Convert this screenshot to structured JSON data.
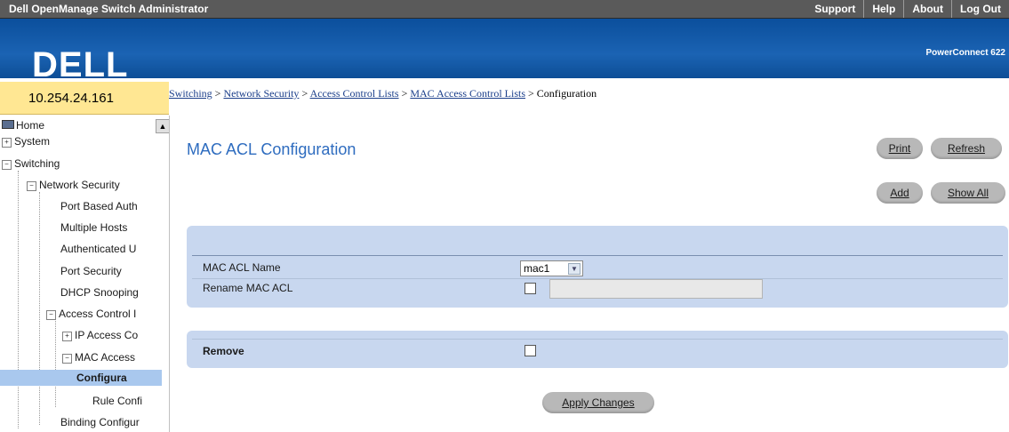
{
  "topbar": {
    "app_title": "Dell OpenManage Switch Administrator",
    "links": [
      "Support",
      "Help",
      "About",
      "Log Out"
    ]
  },
  "header": {
    "logo": "DELL",
    "product": "PowerConnect 622"
  },
  "ip_address": "10.254.24.161",
  "breadcrumb": {
    "items": [
      "Switching",
      "Network Security",
      "Access Control Lists",
      "MAC Access Control Lists"
    ],
    "current": "Configuration",
    "separator": ">"
  },
  "nav": {
    "items": [
      {
        "label": "Home"
      },
      {
        "label": "System"
      },
      {
        "label": "Switching"
      },
      {
        "label": "Network Security"
      },
      {
        "label": "Port Based Auth"
      },
      {
        "label": "Multiple Hosts"
      },
      {
        "label": "Authenticated U"
      },
      {
        "label": "Port Security"
      },
      {
        "label": "DHCP Snooping"
      },
      {
        "label": "Access Control I"
      },
      {
        "label": "IP Access Co"
      },
      {
        "label": "MAC Access"
      },
      {
        "label": "Configura"
      },
      {
        "label": "Rule Confi"
      },
      {
        "label": "Binding Configur"
      }
    ]
  },
  "main": {
    "title": "MAC ACL Configuration",
    "buttons": {
      "print": "Print",
      "refresh": "Refresh",
      "add": "Add",
      "show_all": "Show All",
      "apply": "Apply Changes"
    },
    "fields": {
      "name_label": "MAC ACL Name",
      "name_value": "mac1",
      "rename_label": "Rename MAC ACL",
      "remove_label": "Remove"
    }
  },
  "colors": {
    "header_blue": "#1b63b3",
    "title_blue": "#2e6cbf",
    "panel": "#c8d7ef",
    "ip_box": "#ffe793"
  }
}
